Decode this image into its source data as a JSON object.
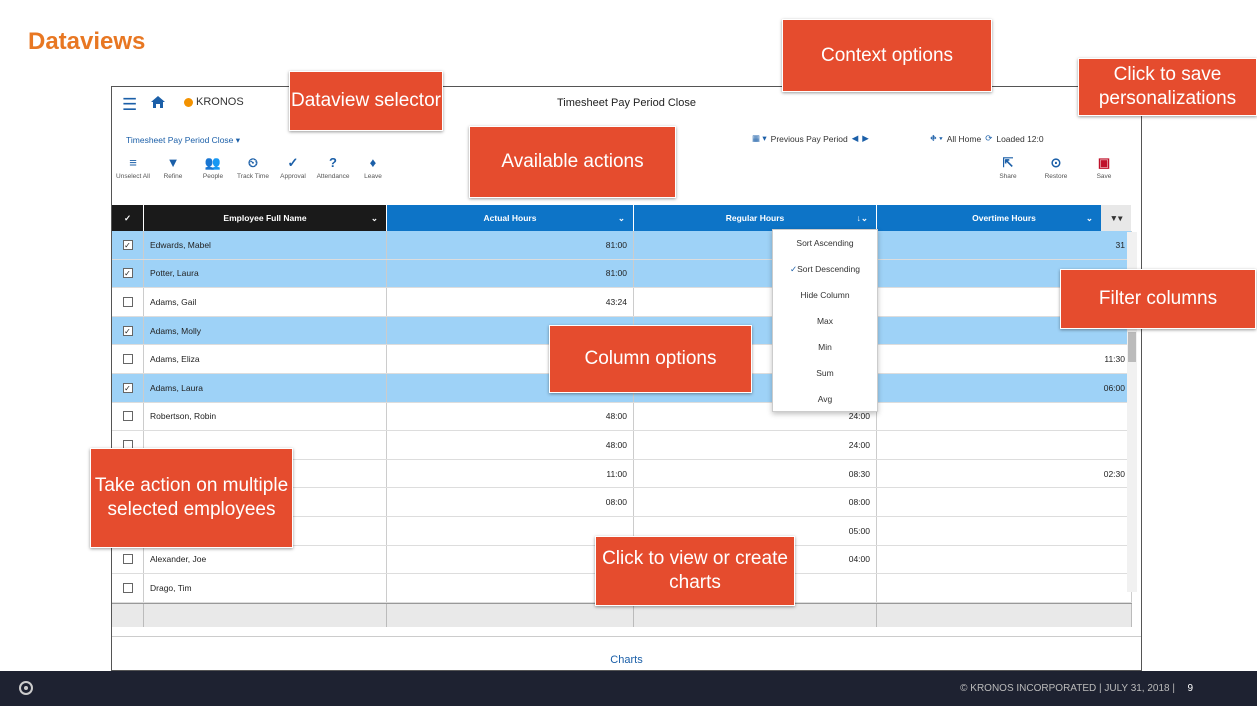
{
  "slide": {
    "title": "Dataviews",
    "page": "9",
    "footer": "© KRONOS INCORPORATED   |  JULY 31, 2018  |"
  },
  "app": {
    "title": "Timesheet Pay Period Close",
    "brand": "KRONOS",
    "dataview": "Timesheet Pay Period Close",
    "period": "Previous Pay Period",
    "location": "All Home",
    "loaded": "Loaded 12:0",
    "charts": "Charts"
  },
  "actions": [
    {
      "label": "Unselect All",
      "icon": "unselect-all-icon",
      "glyph": "≡"
    },
    {
      "label": "Refine",
      "icon": "filter-icon",
      "glyph": "▼"
    },
    {
      "label": "People",
      "icon": "people-icon",
      "glyph": "👥"
    },
    {
      "label": "Track Time",
      "icon": "track-time-icon",
      "glyph": "⏲"
    },
    {
      "label": "Approval",
      "icon": "approval-icon",
      "glyph": "✓"
    },
    {
      "label": "Attendance",
      "icon": "attendance-icon",
      "glyph": "?"
    },
    {
      "label": "Leave",
      "icon": "leave-icon",
      "glyph": "♦"
    }
  ],
  "right_actions": [
    {
      "label": "Share"
    },
    {
      "label": "Restore"
    },
    {
      "label": "Save"
    }
  ],
  "columns": [
    "Employee Full Name",
    "Actual Hours",
    "Regular Hours",
    "Overtime Hours"
  ],
  "rows": [
    {
      "name": "Edwards, Mabel",
      "actual": "81:00",
      "regular": "",
      "overtime": "31",
      "sel": true
    },
    {
      "name": "Potter, Laura",
      "actual": "81:00",
      "regular": "",
      "overtime": "",
      "sel": true
    },
    {
      "name": "Adams, Gail",
      "actual": "43:24",
      "regular": "",
      "overtime": "",
      "sel": false
    },
    {
      "name": "Adams, Molly",
      "actual": "",
      "regular": "",
      "overtime": "",
      "sel": true
    },
    {
      "name": "Adams, Eliza",
      "actual": "",
      "regular": "",
      "overtime": "11:30",
      "sel": false
    },
    {
      "name": "Adams, Laura",
      "actual": "",
      "regular": "",
      "overtime": "06:00",
      "sel": true
    },
    {
      "name": "Robertson, Robin",
      "actual": "48:00",
      "regular": "24:00",
      "overtime": "",
      "sel": false
    },
    {
      "name": "",
      "actual": "48:00",
      "regular": "24:00",
      "overtime": "",
      "sel": false
    },
    {
      "name": "",
      "actual": "11:00",
      "regular": "08:30",
      "overtime": "02:30",
      "sel": false
    },
    {
      "name": "",
      "actual": "08:00",
      "regular": "08:00",
      "overtime": "",
      "sel": false
    },
    {
      "name": "",
      "actual": "",
      "regular": "05:00",
      "overtime": "",
      "sel": false
    },
    {
      "name": "Alexander, Joe",
      "actual": "",
      "regular": "04:00",
      "overtime": "",
      "sel": false
    },
    {
      "name": "Drago, Tim",
      "actual": "",
      "regular": "",
      "overtime": "",
      "sel": false
    }
  ],
  "column_menu": [
    "Sort Ascending",
    "Sort Descending",
    "Hide Column",
    "Max",
    "Min",
    "Sum",
    "Avg"
  ],
  "callouts": {
    "dataview_selector": "Dataview selector",
    "context_options": "Context options",
    "save": "Click to save personalizations",
    "available_actions": "Available actions",
    "filter_columns": "Filter columns",
    "column_options": "Column options",
    "multi_select": "Take action on multiple selected employees",
    "charts": "Click to view or create charts"
  },
  "colors": {
    "accent": "#e87722",
    "callout": "#e54c2e",
    "header_blue": "#0d74c7",
    "selected_row": "#9ed2f7"
  }
}
